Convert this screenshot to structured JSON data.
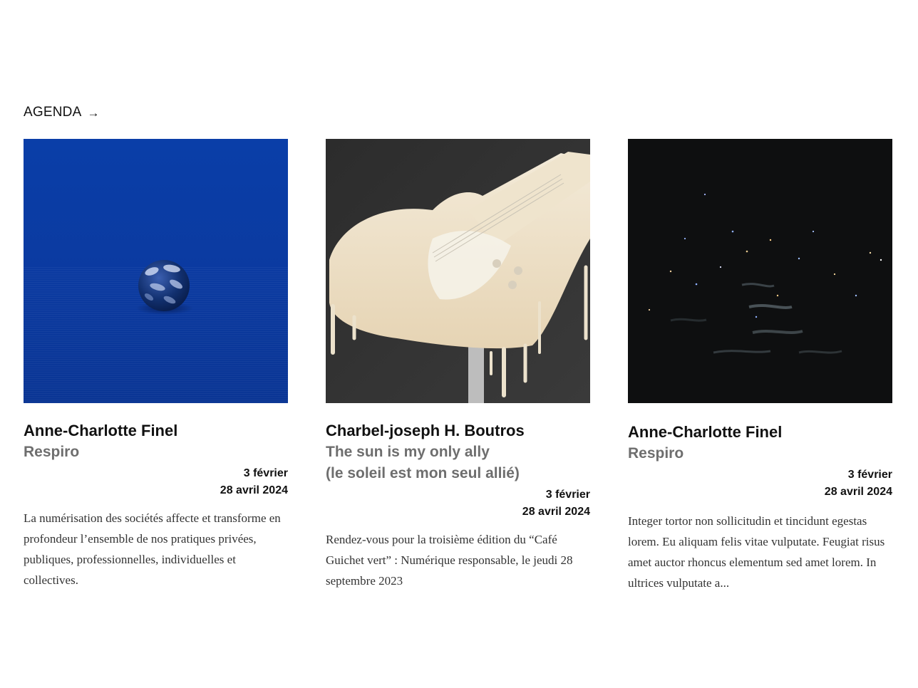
{
  "section": {
    "label": "AGENDA",
    "arrow_glyph": "→"
  },
  "cards": [
    {
      "artist": "Anne-Charlotte Finel",
      "title": "Respiro",
      "date_start": "3 février",
      "date_end": "28 avril 2024",
      "description": "La numérisation des sociétés affecte et transforme en profondeur l’ensemble de nos pratiques privées, publiques, professionnelles, individuelles et collectives.",
      "image_subject": "blue sphere on blue fabric"
    },
    {
      "artist": "Charbel-joseph H. Boutros",
      "title": "The sun is my only ally\n(le soleil est mon seul allié)",
      "date_start": "3 février",
      "date_end": "28 avril 2024",
      "description": "Rendez-vous pour la troisième édition du “Café Guichet vert” : Numérique responsable, le jeudi 28 septembre 2023",
      "image_subject": "melting wax guitar"
    },
    {
      "artist": "Anne-Charlotte Finel",
      "title": "Respiro",
      "date_start": "3 février",
      "date_end": "28 avril 2024",
      "description": "Integer tortor non sollicitudin et tincidunt egestas lorem. Eu aliquam felis vitae vulputate. Feugiat risus amet auctor rhoncus elementum sed amet lorem. In ultrices vulputate a...",
      "image_subject": "dark night water with lights"
    }
  ],
  "colors": {
    "text": "#111111",
    "title_gray": "#6e6e6e",
    "body_text": "#333333",
    "blue": "#0a3a9e"
  }
}
